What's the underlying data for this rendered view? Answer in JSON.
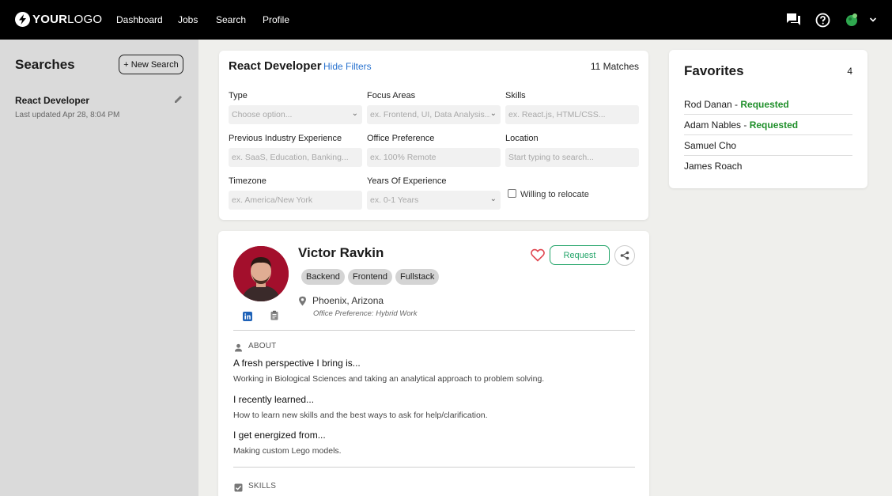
{
  "nav": {
    "logo_bold": "YOUR",
    "logo_light": "LOGO",
    "links": [
      "Dashboard",
      "Jobs",
      "Search",
      "Profile"
    ]
  },
  "sidebar": {
    "title": "Searches",
    "new_search_label": "+ New Search",
    "saved": [
      {
        "name": "React Developer",
        "updated": "Last updated Apr 28, 8:04 PM"
      }
    ]
  },
  "filters": {
    "title": "React Developer",
    "hide_label": "Hide Filters",
    "matches": "11 Matches",
    "fields": {
      "type": {
        "label": "Type",
        "placeholder": "Choose option..."
      },
      "focus": {
        "label": "Focus Areas",
        "placeholder": "ex. Frontend, UI, Data Analysis..."
      },
      "skills": {
        "label": "Skills",
        "placeholder": "ex. React.js, HTML/CSS..."
      },
      "industry": {
        "label": "Previous Industry Experience",
        "placeholder": "ex. SaaS, Education, Banking..."
      },
      "office": {
        "label": "Office Preference",
        "placeholder": "ex. 100% Remote"
      },
      "location": {
        "label": "Location",
        "placeholder": "Start typing to search..."
      },
      "timezone": {
        "label": "Timezone",
        "placeholder": "ex. America/New York"
      },
      "years": {
        "label": "Years Of Experience",
        "placeholder": "ex. 0-1 Years"
      }
    },
    "relocate_label": "Willing to relocate"
  },
  "favorites": {
    "title": "Favorites",
    "count": "4",
    "items": [
      {
        "name": "Rod Danan",
        "status": "Requested"
      },
      {
        "name": "Adam Nables",
        "status": "Requested"
      },
      {
        "name": "Samuel Cho",
        "status": ""
      },
      {
        "name": "James Roach",
        "status": ""
      }
    ],
    "separator": " - "
  },
  "profile": {
    "name": "Victor Ravkin",
    "tags": [
      "Backend",
      "Frontend",
      "Fullstack"
    ],
    "request_label": "Request",
    "location": "Phoenix, Arizona",
    "office_pref": "Office Preference: Hybrid Work",
    "about_label": "ABOUT",
    "about": [
      {
        "q": "A fresh perspective I bring is...",
        "a": "Working in Biological Sciences and taking an analytical approach to problem solving."
      },
      {
        "q": "I recently learned...",
        "a": "How to learn new skills and the best ways to ask for help/clarification."
      },
      {
        "q": "I get energized from...",
        "a": "Making custom Lego models."
      }
    ],
    "skills_label": "SKILLS"
  },
  "colors": {
    "accent_blue": "#2a73cf",
    "requested_green": "#1f8f2a",
    "request_button": "#24a56a",
    "heart": "#e0454f",
    "avatar_bg": "#a30f2c"
  },
  "icons": [
    "bolt-logo-icon",
    "chat-icon",
    "help-icon",
    "user-avatar-icon",
    "chevron-down-icon",
    "pencil-icon",
    "heart-icon",
    "share-icon",
    "map-pin-icon",
    "linkedin-icon",
    "clipboard-icon",
    "person-icon",
    "checkbox-icon"
  ]
}
